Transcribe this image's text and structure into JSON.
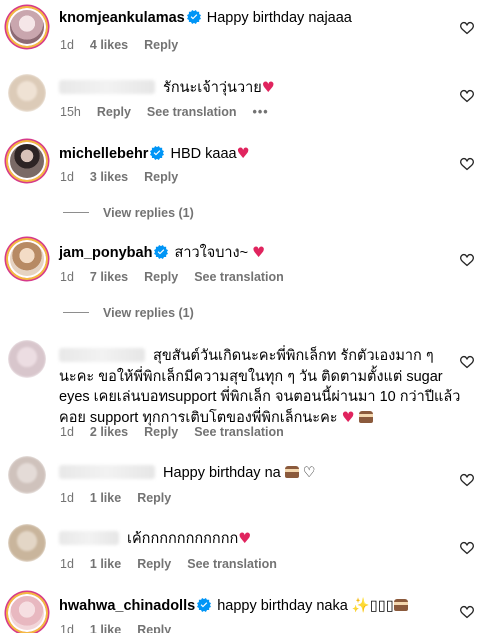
{
  "comments": [
    {
      "username": "knomjeankulamas",
      "verified": true,
      "text": "Happy birthday najaaa",
      "time": "1d",
      "likes": "4 likes",
      "reply": "Reply",
      "translate": ""
    },
    {
      "username": "",
      "verified": false,
      "text": "รักนะเจ้าวุ่นวาย",
      "time": "15h",
      "likes": "",
      "reply": "Reply",
      "translate": "See translation",
      "more": "•••"
    },
    {
      "username": "michellebehr",
      "verified": true,
      "text": "HBD kaaa",
      "time": "1d",
      "likes": "3 likes",
      "reply": "Reply",
      "translate": "",
      "view_replies": "View replies (1)"
    },
    {
      "username": "jam_ponybah",
      "verified": true,
      "text": "สาวใจบาง~",
      "time": "1d",
      "likes": "7 likes",
      "reply": "Reply",
      "translate": "See translation",
      "view_replies": "View replies (1)"
    },
    {
      "username": "",
      "verified": false,
      "text": "สุขสันต์วันเกิดนะคะพี่พิกเล็กท รักตัวเองมาก ๆ นะคะ ขอให้พี่พิกเล็กมีความสุขในทุก ๆ วัน ติดตามตั้งแต่ sugar eyes เคยเล่นบอทsupport พี่พิกเล็ก จนตอนนี้ผ่านมา 10 กว่าปีแล้ว คอย support ทุกการเติบโตของพี่พิกเล็กนะคะ",
      "time": "1d",
      "likes": "2 likes",
      "reply": "Reply",
      "translate": "See translation"
    },
    {
      "username": "",
      "verified": false,
      "text": "Happy birthday na",
      "time": "1d",
      "likes": "1 like",
      "reply": "Reply",
      "translate": ""
    },
    {
      "username": "",
      "verified": false,
      "text": "เค้กกกกกกกกกกก",
      "time": "1d",
      "likes": "1 like",
      "reply": "Reply",
      "translate": "See translation"
    },
    {
      "username": "hwahwa_chinadolls",
      "verified": true,
      "text": "happy birthday naka",
      "text_suffix": "✨▯▯▯",
      "time": "1d",
      "likes": "1 like",
      "reply": "Reply",
      "translate": ""
    }
  ],
  "icons": {
    "like": "heart-outline-icon",
    "verified": "verified-badge-icon",
    "emoji_heart": "red-heart-emoji",
    "emoji_cake": "cake-emoji"
  },
  "colors": {
    "verified": "#0095f6",
    "meta": "#737373",
    "heart": "#e0245e"
  }
}
